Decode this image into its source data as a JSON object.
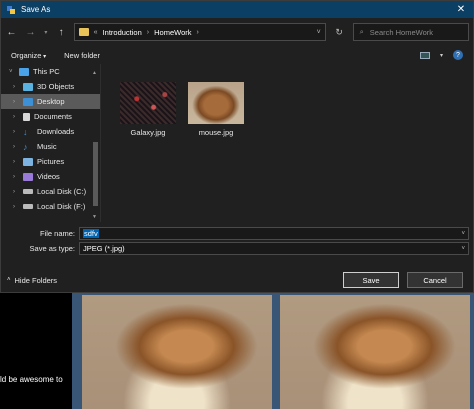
{
  "window": {
    "title": "Save As",
    "close_glyph": "✕"
  },
  "nav": {
    "back_icon": "arrow-left",
    "forward_icon": "arrow-right",
    "up_icon": "arrow-up",
    "breadcrumb": [
      "Introduction",
      "HomeWork"
    ],
    "overflow": "«",
    "search_placeholder": "Search HomeWork"
  },
  "toolbar": {
    "organize": "Organize",
    "new_folder": "New folder"
  },
  "sidebar": {
    "items": [
      {
        "label": "This PC",
        "icon": "pc-icon",
        "color": "#4aa3e8"
      },
      {
        "label": "3D Objects",
        "icon": "cube-icon",
        "color": "#59b2e0"
      },
      {
        "label": "Desktop",
        "icon": "desktop-icon",
        "color": "#3d8fd6",
        "selected": true
      },
      {
        "label": "Documents",
        "icon": "document-icon",
        "color": "#d8d8d8"
      },
      {
        "label": "Downloads",
        "icon": "download-icon",
        "color": "#3d8fd6"
      },
      {
        "label": "Music",
        "icon": "music-icon",
        "color": "#3d8fd6"
      },
      {
        "label": "Pictures",
        "icon": "pictures-icon",
        "color": "#7cb3e0"
      },
      {
        "label": "Videos",
        "icon": "video-icon",
        "color": "#9a7ad8"
      },
      {
        "label": "Local Disk (C:)",
        "icon": "disk-icon",
        "color": "#bbbbbb"
      },
      {
        "label": "Local Disk (F:)",
        "icon": "disk-icon",
        "color": "#bbbbbb"
      }
    ]
  },
  "files": [
    {
      "name": "Galaxy.jpg",
      "thumb": "galaxy"
    },
    {
      "name": "mouse.jpg",
      "thumb": "mouse"
    }
  ],
  "form": {
    "file_name_label": "File name:",
    "file_name_value": "sdfv",
    "type_label": "Save as type:",
    "type_value": "JPEG (*.jpg)"
  },
  "footer": {
    "hide_folders": "Hide Folders",
    "save": "Save",
    "cancel": "Cancel"
  },
  "background": {
    "caption": "ld be awesome to"
  }
}
